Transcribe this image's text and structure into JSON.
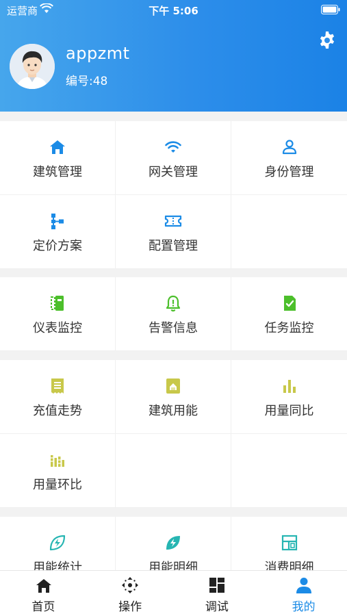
{
  "status_bar": {
    "carrier": "运营商",
    "time": "下午 5:06"
  },
  "profile": {
    "username": "appzmt",
    "id_label": "编号:",
    "id_value": "48"
  },
  "sections": [
    [
      {
        "name": "building-mgmt",
        "label": "建筑管理",
        "icon": "home-icon",
        "color": "#1b8be6"
      },
      {
        "name": "gateway-mgmt",
        "label": "网关管理",
        "icon": "wifi-icon",
        "color": "#1b8be6"
      },
      {
        "name": "identity-mgmt",
        "label": "身份管理",
        "icon": "user-icon",
        "color": "#1b8be6"
      },
      {
        "name": "pricing-plan",
        "label": "定价方案",
        "icon": "hierarchy-icon",
        "color": "#1b8be6"
      },
      {
        "name": "config-mgmt",
        "label": "配置管理",
        "icon": "ticket-icon",
        "color": "#1b8be6"
      }
    ],
    [
      {
        "name": "meter-monitor",
        "label": "仪表监控",
        "icon": "meter-icon",
        "color": "#4cbf2b"
      },
      {
        "name": "alarm-info",
        "label": "告警信息",
        "icon": "bell-icon",
        "color": "#4cbf2b"
      },
      {
        "name": "task-monitor",
        "label": "任务监控",
        "icon": "task-doc-icon",
        "color": "#4cbf2b"
      }
    ],
    [
      {
        "name": "recharge-trend",
        "label": "充值走势",
        "icon": "receipt-icon",
        "color": "#c8c84a"
      },
      {
        "name": "building-energy",
        "label": "建筑用能",
        "icon": "building-doc-icon",
        "color": "#c8c84a"
      },
      {
        "name": "usage-yoy",
        "label": "用量同比",
        "icon": "bar-chart-icon",
        "color": "#c8c84a"
      },
      {
        "name": "usage-mom",
        "label": "用量环比",
        "icon": "multi-bar-icon",
        "color": "#c8c84a"
      }
    ],
    [
      {
        "name": "energy-stats",
        "label": "用能统计",
        "icon": "leaf-bolt-icon",
        "color": "#26b5b2"
      },
      {
        "name": "energy-detail",
        "label": "用能明细",
        "icon": "leaf-bolt-solid-icon",
        "color": "#26b5b2"
      },
      {
        "name": "consumption-detail",
        "label": "消费明细",
        "icon": "layout-icon",
        "color": "#26b5b2"
      }
    ]
  ],
  "tabs": [
    {
      "name": "home",
      "label": "首页",
      "icon": "home-icon",
      "active": false
    },
    {
      "name": "operate",
      "label": "操作",
      "icon": "move-arrows-icon",
      "active": false
    },
    {
      "name": "debug",
      "label": "调试",
      "icon": "dashboard-icon",
      "active": false
    },
    {
      "name": "mine",
      "label": "我的",
      "icon": "person-icon",
      "active": true
    }
  ],
  "colors": {
    "primary": "#1b8be6",
    "tab_active": "#1b8be6",
    "tab_inactive": "#222222"
  }
}
